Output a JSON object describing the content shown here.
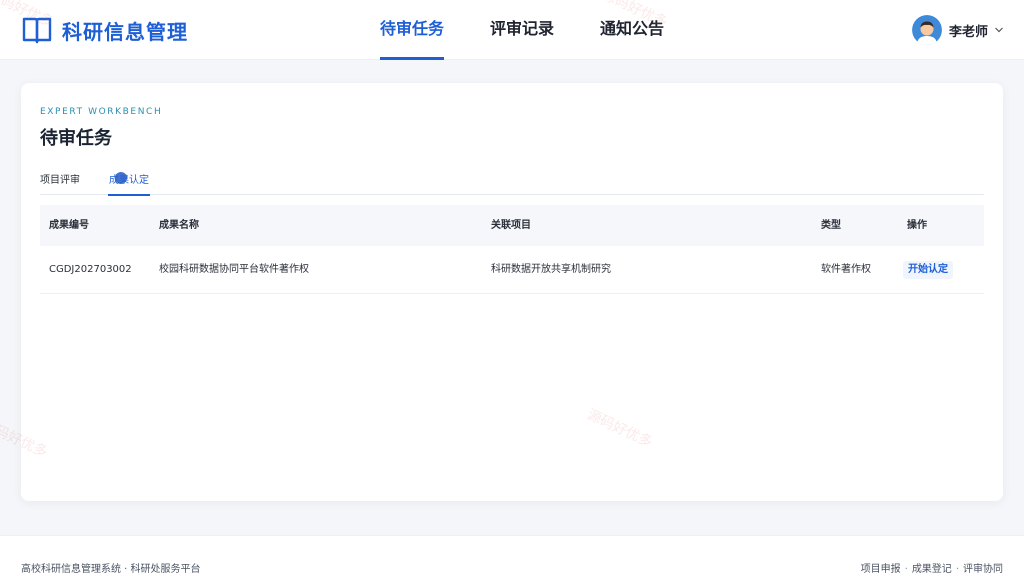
{
  "app": {
    "title": "科研信息管理"
  },
  "nav": {
    "items": [
      {
        "label": "待审任务",
        "active": true
      },
      {
        "label": "评审记录",
        "active": false
      },
      {
        "label": "通知公告",
        "active": false
      }
    ]
  },
  "user": {
    "name": "李老师",
    "avatar_icon": "avatar-icon",
    "menu_icon": "chevron-down-icon"
  },
  "page": {
    "eyebrow": "EXPERT WORKBENCH",
    "title": "待审任务",
    "tabs": [
      {
        "label": "项目评审",
        "active": false
      },
      {
        "label": "成果认定",
        "active": true
      }
    ]
  },
  "table": {
    "columns": [
      "成果编号",
      "成果名称",
      "关联项目",
      "类型",
      "操作"
    ],
    "rows": [
      {
        "id": "CGDJ202703002",
        "name": "校园科研数据协同平台软件著作权",
        "project": "科研数据开放共享机制研究",
        "type": "软件著作权",
        "action": "开始认定"
      }
    ]
  },
  "footer": {
    "left": "高校科研信息管理系统 · 科研处服务平台",
    "links": [
      "项目申报",
      "成果登记",
      "评审协同"
    ],
    "separator": "·"
  },
  "watermark": "源码好优多",
  "colors": {
    "primary": "#1e5fd6",
    "eyebrow": "#2a8fb0",
    "background": "#f4f6f9"
  }
}
